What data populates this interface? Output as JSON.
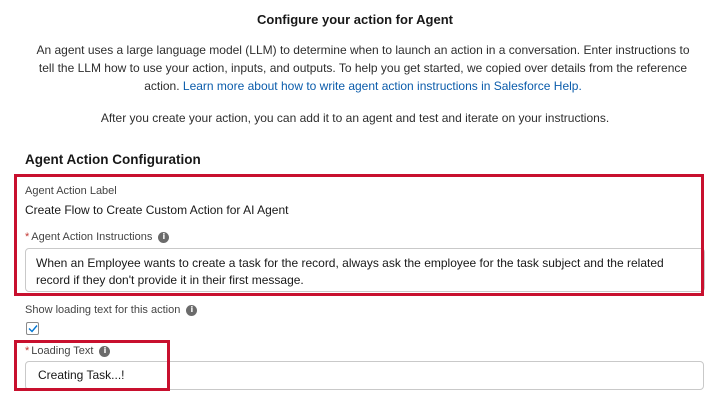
{
  "modal": {
    "title": "Configure your action for Agent",
    "intro_text": "An agent uses a large language model (LLM) to determine when to launch an action in a conversation. Enter instructions to tell the LLM how to use your action, inputs, and outputs. To help you get started, we copied over details from the reference action.",
    "help_link": "Learn more about how to write agent action instructions in Salesforce Help.",
    "note": "After you create your action, you can add it to an agent and test and iterate on your instructions."
  },
  "section": {
    "title": "Agent Action Configuration"
  },
  "fields": {
    "action_label": {
      "label": "Agent Action Label",
      "value": "Create Flow to Create Custom Action for AI Agent"
    },
    "instructions": {
      "required_mark": "*",
      "label": "Agent Action Instructions",
      "value": "When an Employee wants to create a task for the record, always ask the employee for the task subject and the related record if they don't provide it in their first message."
    },
    "show_loading": {
      "label": "Show loading text for this action",
      "checked": true
    },
    "loading_text": {
      "required_mark": "*",
      "label": "Loading Text",
      "value": "Creating Task...!"
    }
  },
  "icons": {
    "info": "info-icon",
    "checkmark": "checkmark-icon"
  },
  "colors": {
    "highlight": "#c8102e",
    "link": "#0b5cab",
    "required": "#c23934"
  }
}
